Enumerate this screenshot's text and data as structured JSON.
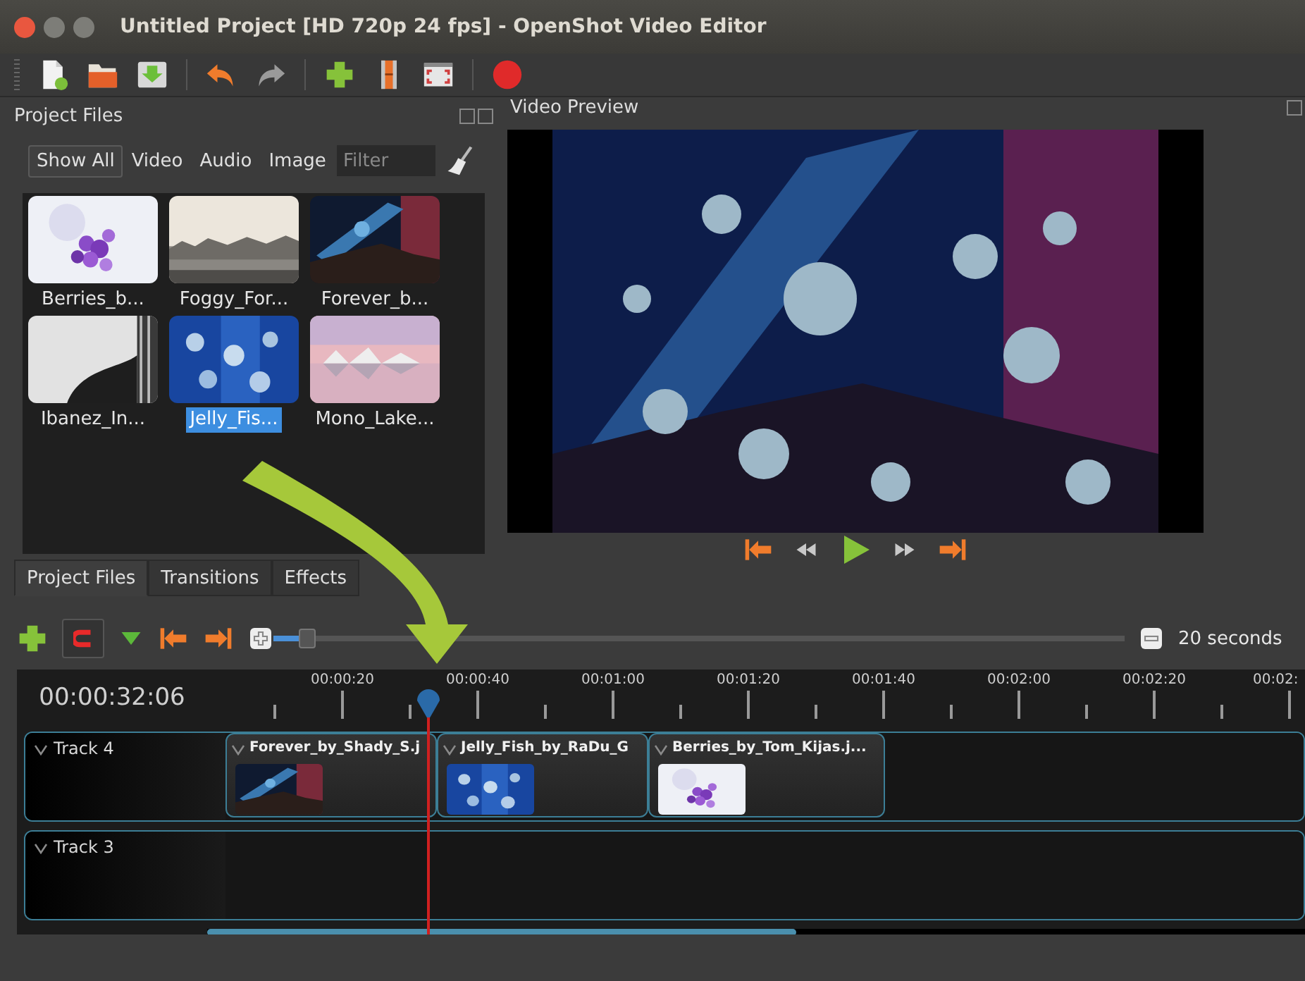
{
  "window": {
    "title": "Untitled Project [HD 720p 24 fps] - OpenShot Video Editor"
  },
  "project_files": {
    "title": "Project Files",
    "filters": [
      {
        "label": "Show All",
        "selected": true
      },
      {
        "label": "Video",
        "selected": false
      },
      {
        "label": "Audio",
        "selected": false
      },
      {
        "label": "Image",
        "selected": false
      }
    ],
    "search": {
      "placeholder": "Filter"
    },
    "files": [
      {
        "name": "Berries_b...",
        "selected": false
      },
      {
        "name": "Foggy_For...",
        "selected": false
      },
      {
        "name": "Forever_b...",
        "selected": false
      },
      {
        "name": "Ibanez_In...",
        "selected": false
      },
      {
        "name": "Jelly_Fis...",
        "selected": true
      },
      {
        "name": "Mono_Lake...",
        "selected": false
      }
    ]
  },
  "video_preview": {
    "title": "Video Preview"
  },
  "tabs": [
    {
      "label": "Project Files",
      "selected": true
    },
    {
      "label": "Transitions",
      "selected": false
    },
    {
      "label": "Effects",
      "selected": false
    }
  ],
  "timeline": {
    "snapping": true,
    "zoom": {
      "level": 0.03,
      "label": "20 seconds"
    },
    "timecode": "00:00:32:06",
    "ruler": [
      "00:00:20",
      "00:00:40",
      "00:01:00",
      "00:01:20",
      "00:01:40",
      "00:02:00",
      "00:02:20",
      "00:02:"
    ],
    "tracks": [
      {
        "name": "Track 4",
        "clips": [
          {
            "title": "Forever_by_Shady_S.j"
          },
          {
            "title": "Jelly_Fish_by_RaDu_G"
          },
          {
            "title": "Berries_by_Tom_Kijas.j..."
          }
        ]
      },
      {
        "name": "Track 3"
      }
    ]
  }
}
